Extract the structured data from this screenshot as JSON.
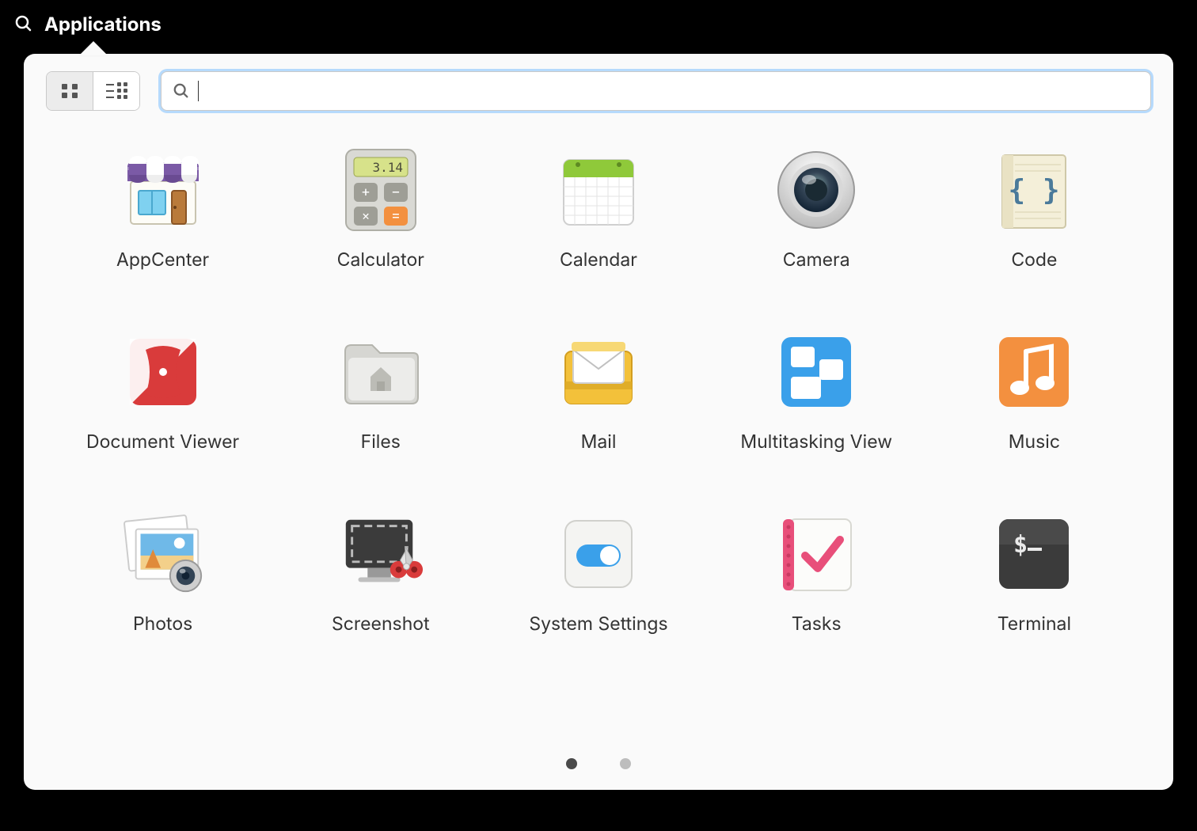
{
  "topbar": {
    "title": "Applications"
  },
  "search": {
    "value": "",
    "placeholder": ""
  },
  "view_mode": "grid",
  "pages": {
    "count": 2,
    "current": 1
  },
  "apps": [
    {
      "id": "appcenter",
      "label": "AppCenter",
      "icon": "appcenter-icon"
    },
    {
      "id": "calculator",
      "label": "Calculator",
      "icon": "calculator-icon"
    },
    {
      "id": "calendar",
      "label": "Calendar",
      "icon": "calendar-icon"
    },
    {
      "id": "camera",
      "label": "Camera",
      "icon": "camera-icon"
    },
    {
      "id": "code",
      "label": "Code",
      "icon": "code-icon"
    },
    {
      "id": "docviewer",
      "label": "Document Viewer",
      "icon": "docviewer-icon"
    },
    {
      "id": "files",
      "label": "Files",
      "icon": "files-icon"
    },
    {
      "id": "mail",
      "label": "Mail",
      "icon": "mail-icon"
    },
    {
      "id": "multitask",
      "label": "Multitasking View",
      "icon": "multitask-icon"
    },
    {
      "id": "music",
      "label": "Music",
      "icon": "music-icon"
    },
    {
      "id": "photos",
      "label": "Photos",
      "icon": "photos-icon"
    },
    {
      "id": "screenshot",
      "label": "Screenshot",
      "icon": "screenshot-icon"
    },
    {
      "id": "settings",
      "label": "System Settings",
      "icon": "settings-icon"
    },
    {
      "id": "tasks",
      "label": "Tasks",
      "icon": "tasks-icon"
    },
    {
      "id": "terminal",
      "label": "Terminal",
      "icon": "terminal-icon"
    }
  ],
  "calculator_display": "3.14",
  "terminal_prompt": "$_",
  "colors": {
    "accent_blue": "#3aa0ea",
    "orange": "#f3903f",
    "green": "#8fc93a",
    "yellow": "#f3c13a",
    "red": "#d93b3b",
    "pink": "#e84f7a",
    "purple": "#7b5aa6",
    "dark": "#3b3b3b"
  }
}
